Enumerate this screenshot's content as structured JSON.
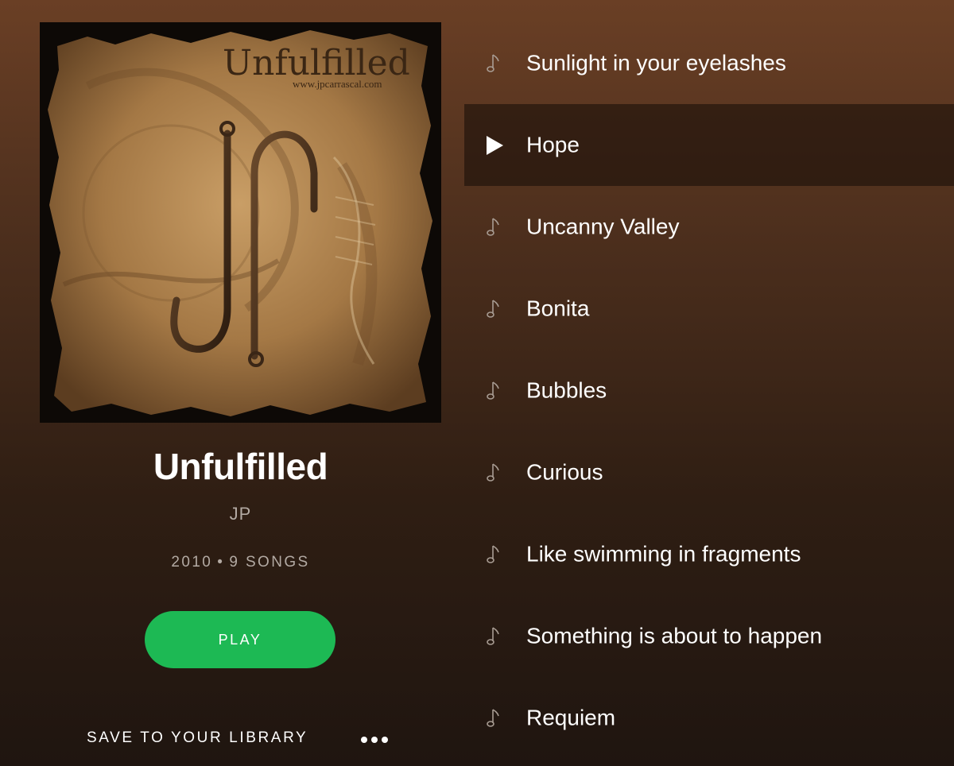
{
  "album": {
    "title": "Unfulfilled",
    "artist": "JP",
    "year": "2010",
    "separator": "•",
    "song_count": "9 SONGS",
    "cover": {
      "title_text": "Unfulfilled",
      "url_text": "www.jpcarrascal.com"
    }
  },
  "actions": {
    "play_label": "PLAY",
    "save_label": "SAVE TO YOUR LIBRARY",
    "more_icon": "more-dots-icon"
  },
  "tracks": [
    {
      "title": "Sunlight in your eyelashes",
      "icon": "music-note-icon",
      "active": false
    },
    {
      "title": "Hope",
      "icon": "play-icon",
      "active": true
    },
    {
      "title": "Uncanny Valley",
      "icon": "music-note-icon",
      "active": false
    },
    {
      "title": "Bonita",
      "icon": "music-note-icon",
      "active": false
    },
    {
      "title": "Bubbles",
      "icon": "music-note-icon",
      "active": false
    },
    {
      "title": "Curious",
      "icon": "music-note-icon",
      "active": false
    },
    {
      "title": "Like swimming in fragments",
      "icon": "music-note-icon",
      "active": false
    },
    {
      "title": "Something is about to happen",
      "icon": "music-note-icon",
      "active": false
    },
    {
      "title": "Requiem",
      "icon": "music-note-icon",
      "active": false
    }
  ],
  "colors": {
    "accent_green": "#1db954",
    "background_top": "#6a3f25",
    "background_bottom": "#1f1510",
    "muted_text": "#b3aaa3"
  }
}
